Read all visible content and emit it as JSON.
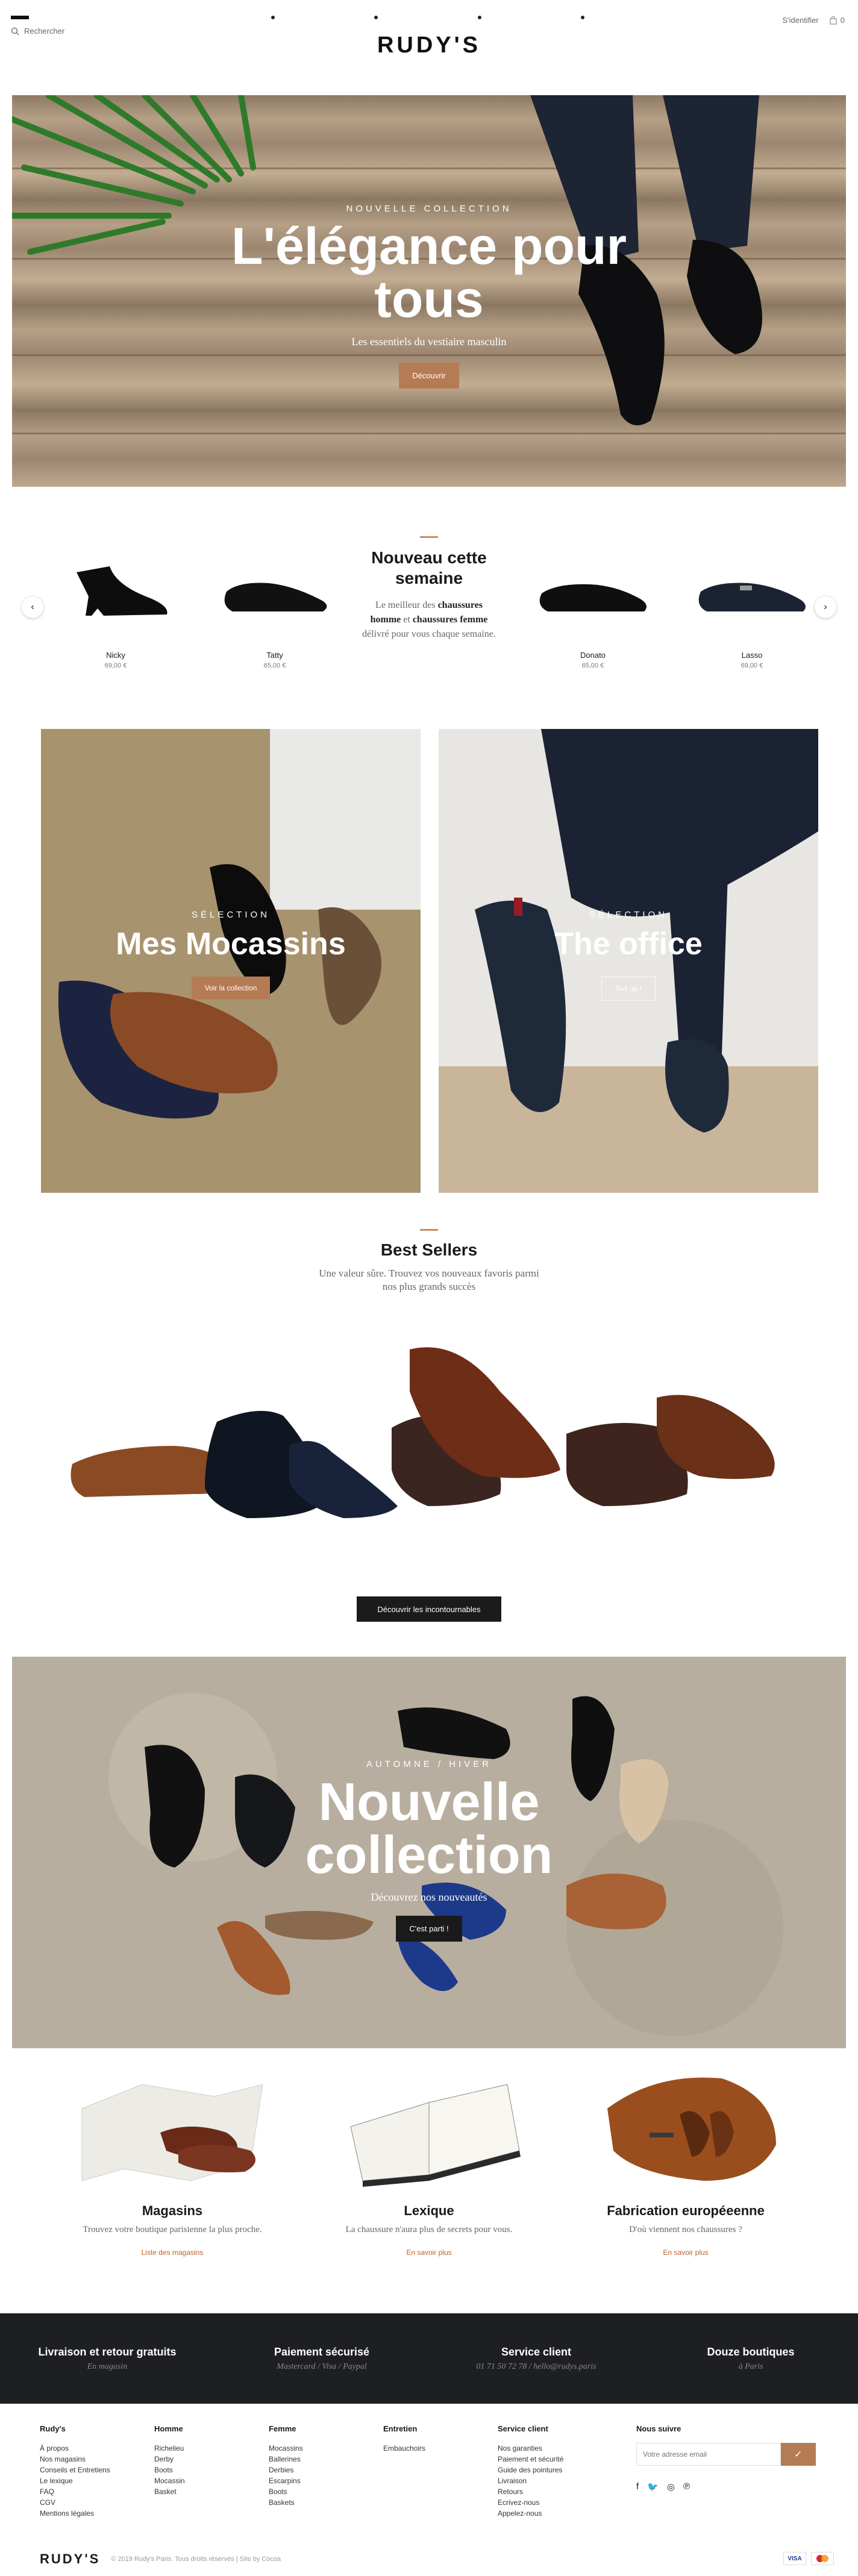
{
  "header": {
    "search_label": "Rechercher",
    "logo": "RUDY'S",
    "login_label": "S'identifier",
    "cart_count": "0"
  },
  "hero": {
    "eyebrow": "Nouvelle collection",
    "title": "L'élégance pour tous",
    "subtitle": "Les essentiels du vestiaire masculin",
    "cta": "Découvrir"
  },
  "new_week": {
    "title": "Nouveau cette semaine",
    "text_before": "Le meilleur des",
    "bold1": "chaussures homme",
    "text_mid": "et",
    "bold2": "chaussures femme",
    "text_after": "délivré pour vous chaque semaine.",
    "products": [
      {
        "name": "Nicky",
        "price": "69,00 €"
      },
      {
        "name": "Tatty",
        "price": "65,00 €"
      },
      {
        "name": "Donato",
        "price": "65,00 €"
      },
      {
        "name": "Lasso",
        "price": "69,00 €"
      }
    ]
  },
  "selections": [
    {
      "eyebrow": "Sélection",
      "title": "Mes Mocassins",
      "cta": "Voir la collection"
    },
    {
      "eyebrow": "Sélection",
      "title": "The office",
      "cta": "Suit up !"
    }
  ],
  "best_sellers": {
    "title": "Best Sellers",
    "text": "Une valeur sûre. Trouvez vos nouveaux favoris parmi nos plus grands succès",
    "cta": "Découvrir les incontournables"
  },
  "autumn": {
    "eyebrow": "Automne / Hiver",
    "title": "Nouvelle collection",
    "subtitle": "Découvrez nos nouveautés",
    "cta": "C'est parti !"
  },
  "info": [
    {
      "title": "Magasins",
      "text": "Trouvez votre boutique parisienne la plus proche.",
      "link": "Liste des magasins"
    },
    {
      "title": "Lexique",
      "text": "La chaussure n'aura plus de secrets pour vous.",
      "link": "En savoir plus"
    },
    {
      "title": "Fabrication européeenne",
      "text": "D'où viennent nos chaussures ?",
      "link": "En savoir plus"
    }
  ],
  "reassurance": [
    {
      "title": "Livraison et retour gratuits",
      "sub": "En magasin"
    },
    {
      "title": "Paiement sécurisé",
      "sub": "Mastercard / Visa / Paypal"
    },
    {
      "title": "Service client",
      "sub": "01 71 50 72 78 / hello@rudys.paris"
    },
    {
      "title": "Douze boutiques",
      "sub": "à Paris"
    }
  ],
  "footer": {
    "cols": [
      {
        "title": "Rudy's",
        "links": [
          "À propos",
          "Nos magasins",
          "Conseils et Entretiens",
          "Le lexique",
          "FAQ",
          "CGV",
          "Mentions légales"
        ]
      },
      {
        "title": "Homme",
        "links": [
          "Richelieu",
          "Derby",
          "Boots",
          "Mocassin",
          "Basket"
        ]
      },
      {
        "title": "Femme",
        "links": [
          "Mocassins",
          "Ballerines",
          "Derbies",
          "Escarpins",
          "Boots",
          "Baskets"
        ]
      },
      {
        "title": "Entretien",
        "links": [
          "Embauchoirs"
        ]
      },
      {
        "title": "Service client",
        "links": [
          "Nos garanties",
          "Paiement et sécurité",
          "Guide des pointures",
          "Livraison",
          "Retours",
          "Ecrivez-nous",
          "Appelez-nous"
        ]
      }
    ],
    "newsletter_title": "Nous suivre",
    "newsletter_placeholder": "Votre adresse email",
    "bottom_logo": "RUDY'S",
    "copyright": "© 2019 Rudy's Paris. Tous droits réservés | Site by Cocoa",
    "pay1": "VISA"
  },
  "colors": {
    "accent": "#b57b54",
    "dark": "#1e1f22",
    "link": "#c0612f"
  }
}
